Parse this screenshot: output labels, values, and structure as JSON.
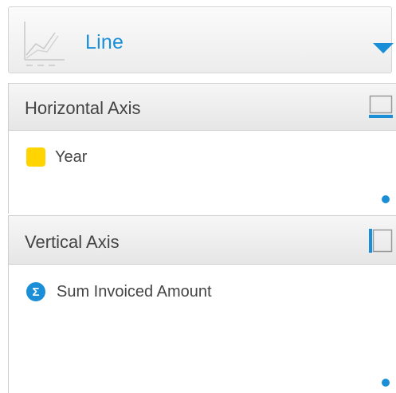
{
  "chart_type": {
    "label": "Line",
    "icon": "line-chart-icon",
    "accent_color": "#1a8fd8"
  },
  "sections": {
    "horizontal": {
      "title": "Horizontal Axis",
      "icon": "horizontal-axis-icon",
      "fields": [
        {
          "label": "Year",
          "icon": "dimension-swatch-icon",
          "color": "#ffd400"
        }
      ]
    },
    "vertical": {
      "title": "Vertical Axis",
      "icon": "vertical-axis-icon",
      "fields": [
        {
          "label": "Sum Invoiced Amount",
          "icon": "sigma-icon",
          "symbol": "Σ",
          "color": "#1a8fd8"
        }
      ]
    }
  }
}
